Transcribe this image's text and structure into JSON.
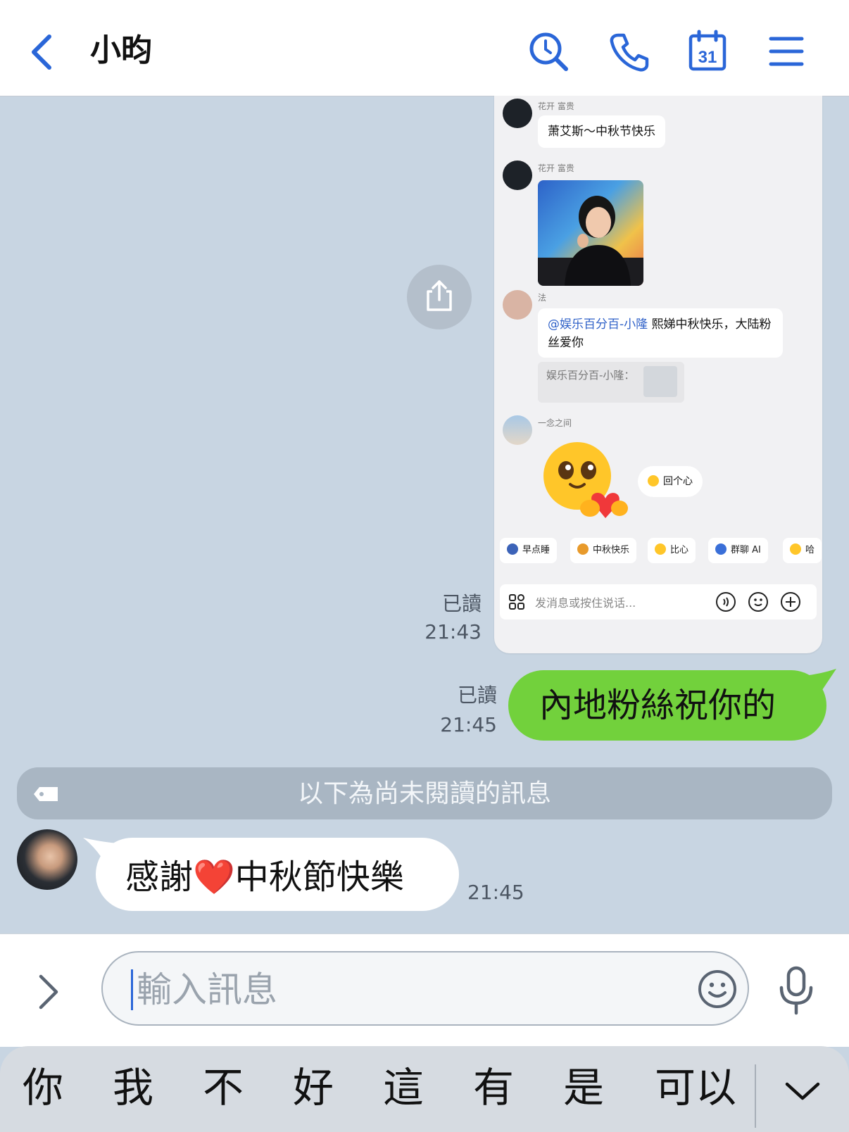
{
  "header": {
    "back": "back-chevron",
    "title": "小昀",
    "icons": [
      "search-icon",
      "phone-icon",
      "calendar-icon",
      "menu-icon"
    ],
    "calendar_day": "31"
  },
  "shared_screenshot": {
    "messages": [
      {
        "name": "花开 富贵",
        "text": "萧艾斯～中秋节快乐"
      },
      {
        "name": "花开 富贵",
        "image": "photo"
      },
      {
        "name": "法",
        "mention": "@娱乐百分百-小隆",
        "text": " 熙娣中秋快乐，大陆粉丝爱你",
        "quote": "娱乐百分百-小隆："
      },
      {
        "name": "一念之间",
        "sticker": "heart-hug-emoji",
        "reply": "回个心"
      }
    ],
    "chips": [
      "早点睡",
      "中秋快乐",
      "比心",
      "群聊 AI",
      "哈"
    ],
    "input_placeholder": "发消息或按住说话..."
  },
  "share_button": "share-icon",
  "meta1": {
    "read": "已讀",
    "time": "21:43"
  },
  "sent": {
    "read": "已讀",
    "time": "21:45",
    "text": "內地粉絲祝你的"
  },
  "unread_divider": "以下為尚未閱讀的訊息",
  "received": {
    "text_before": "感謝",
    "heart": "❤️",
    "text_after": "中秋節快樂",
    "time": "21:45"
  },
  "composer": {
    "placeholder": "輸入訊息"
  },
  "keyboard": {
    "suggestions": [
      "你",
      "我",
      "不",
      "好",
      "這",
      "有",
      "是",
      "可以"
    ]
  },
  "colors": {
    "accent": "#2a66d8",
    "sent_bubble": "#72d13c",
    "chat_bg": "#c8d5e2"
  }
}
